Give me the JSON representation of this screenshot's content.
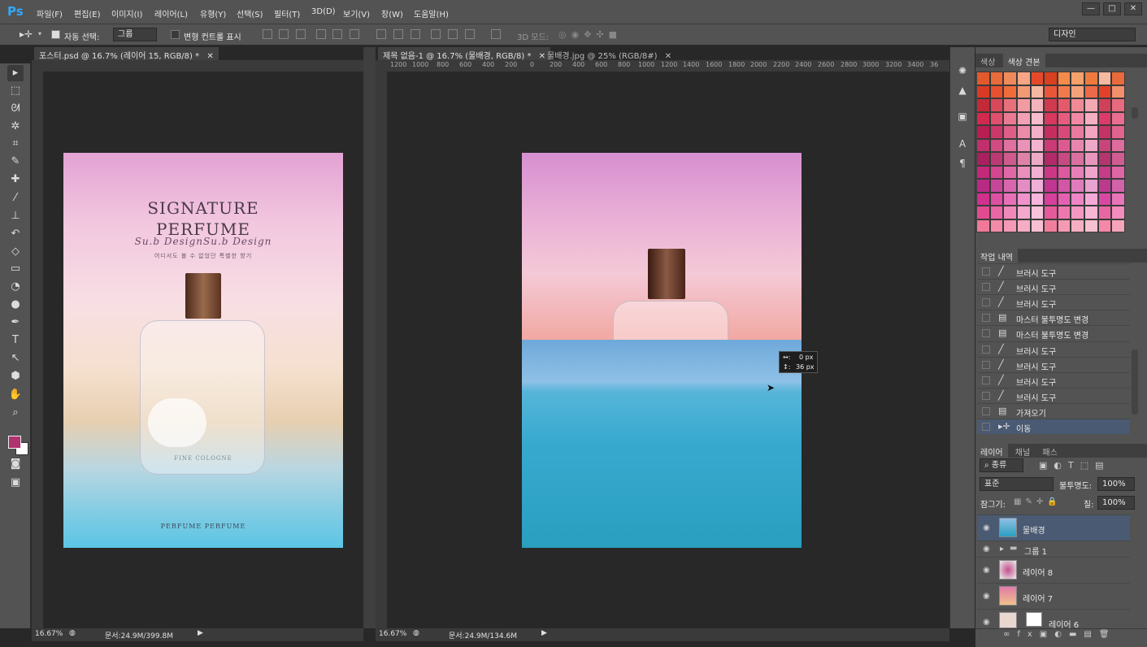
{
  "app": {
    "logo": "Ps"
  },
  "menu": [
    "파일(F)",
    "편집(E)",
    "이미지(I)",
    "레이어(L)",
    "유형(Y)",
    "선택(S)",
    "필터(T)",
    "3D(D)",
    "보기(V)",
    "창(W)",
    "도움말(H)"
  ],
  "window_buttons": [
    "—",
    "□",
    "✕"
  ],
  "options": {
    "auto_select_label": "자동 선택:",
    "auto_select_value": "그룹",
    "transform_label": "변형 컨트롤 표시",
    "mode3d_label": "3D 모드:",
    "workspace": "디자인"
  },
  "tabs_left": [
    {
      "label": "포스터.psd @ 16.7% (레이어 15, RGB/8) *",
      "close": "✕"
    }
  ],
  "tabs_right": [
    {
      "label": "제목 없음-1 @ 16.7% (물배경, RGB/8) *",
      "close": "✕"
    },
    {
      "label": "물배경.jpg @ 25% (RGB/8#)",
      "close": "✕"
    }
  ],
  "ruler_top": [
    "1200",
    "1000",
    "800",
    "600",
    "400",
    "200",
    "0",
    "200",
    "400",
    "600",
    "800",
    "1000",
    "1200",
    "1400",
    "1600",
    "1800",
    "2000",
    "2200",
    "2400",
    "2600",
    "2800",
    "3000",
    "3200",
    "3400",
    "36"
  ],
  "poster": {
    "title1": "SIGNATURE",
    "title2": "PERFUME",
    "script": "Su.b DesignSu.b Design",
    "tagline": "어디서도 볼 수 없었던 특별한 향기",
    "bottle_label": "FINE COLOGNE",
    "footer": "PERFUME PERFUME"
  },
  "move_tooltip": {
    "dx": "0 px",
    "dy": "36 px"
  },
  "status_left": {
    "zoom": "16.67%",
    "doc": "문서:24.9M/399.8M"
  },
  "status_right": {
    "zoom": "16.67%",
    "doc": "문서:24.9M/134.6M"
  },
  "swatch_panel": {
    "tabs": [
      "색상",
      "색상 견본"
    ]
  },
  "swatch_colors": [
    "#e25a2c",
    "#e96a3a",
    "#f08a5b",
    "#f7a585",
    "#e44a2a",
    "#d8401f",
    "#f58b4b",
    "#f4a16c",
    "#ef7a3e",
    "#f5b8a1",
    "#e96a3a",
    "#d93a26",
    "#e8502f",
    "#f06c3a",
    "#f39a75",
    "#f7b8a3",
    "#e9563a",
    "#f17a4d",
    "#f5a27c",
    "#ec6a4a",
    "#e2422a",
    "#f28f6c",
    "#c22a3a",
    "#d9485a",
    "#e8707a",
    "#f29aa2",
    "#f5b4bc",
    "#cf3a4e",
    "#e45a6a",
    "#f08a96",
    "#f4a8b2",
    "#d1405a",
    "#e86a7e",
    "#d12a4e",
    "#e0506e",
    "#ea7a92",
    "#f2a0b4",
    "#f6bdcc",
    "#d8385e",
    "#e65c7e",
    "#f189a4",
    "#f6aec2",
    "#dc3a68",
    "#eb6e92",
    "#b81e52",
    "#cc386a",
    "#de5e88",
    "#ec8aaa",
    "#f4b0c8",
    "#c72e60",
    "#d94a7a",
    "#e87aa0",
    "#f2a4c0",
    "#c43266",
    "#e0648e",
    "#c2306c",
    "#d24a82",
    "#e070a0",
    "#ea92b8",
    "#f2b4d0",
    "#ca3a76",
    "#dc5a90",
    "#e886b0",
    "#f0a8c8",
    "#c8447c",
    "#de6c9c",
    "#a8205e",
    "#bc3a74",
    "#cf5a8e",
    "#df82aa",
    "#ecaac8",
    "#b22a68",
    "#c84a82",
    "#da70a0",
    "#e896bc",
    "#b4366e",
    "#d05c92",
    "#c4287a",
    "#d44690",
    "#e068a6",
    "#ea8ebc",
    "#f2b0d2",
    "#cc3886",
    "#dc5aa0",
    "#e880b8",
    "#f0a4cc",
    "#c63c88",
    "#de66a6",
    "#b82a84",
    "#c8469a",
    "#d866ae",
    "#e48cc4",
    "#eeb0d8",
    "#c03690",
    "#d256a6",
    "#e07cbc",
    "#eaa2d0",
    "#bc3a8e",
    "#d262aa",
    "#d0308e",
    "#de50a4",
    "#e870b8",
    "#f092cc",
    "#f6b6de",
    "#d6409c",
    "#e460b2",
    "#ee86c6",
    "#f4aad8",
    "#d848a2",
    "#e874ba",
    "#e24a90",
    "#ea66a4",
    "#f088ba",
    "#f4a8cc",
    "#f8c4dc",
    "#e45a9a",
    "#ee78ae",
    "#f498c2",
    "#f6b6d4",
    "#e866a2",
    "#f28cbc",
    "#f07898",
    "#f28aa8",
    "#f49ab6",
    "#f6acc4",
    "#f8c0d2",
    "#f27e9e",
    "#f49ab2",
    "#f6aec2",
    "#f8c0d0",
    "#f488a6",
    "#f6a4bc"
  ],
  "history": {
    "tab": "작업 내역",
    "items": [
      "브러시 도구",
      "브러시 도구",
      "브러시 도구",
      "마스터 불투명도 변경",
      "마스터 불투명도 변경",
      "브러시 도구",
      "브러시 도구",
      "브러시 도구",
      "브러시 도구",
      "가져오기",
      "이동"
    ],
    "icons": [
      "brush-icon",
      "brush-icon",
      "brush-icon",
      "document-icon",
      "document-icon",
      "brush-icon",
      "brush-icon",
      "brush-icon",
      "brush-icon",
      "document-icon",
      "move-icon"
    ]
  },
  "layers_panel": {
    "tabs": [
      "레이어",
      "채널",
      "패스"
    ],
    "filter": "종류",
    "blend": "표준",
    "opacity_label": "불투명도:",
    "opacity": "100%",
    "lock_label": "잠그기:",
    "fill_label": "칠:",
    "fill": "100%",
    "layers": [
      "물배경",
      "그룹 1",
      "레이어 8",
      "레이어 7",
      "레이어 6"
    ]
  },
  "colors": {
    "accent": "#31a8ff",
    "foreground": "#b0326e",
    "background": "#ffffff",
    "selection": "#4a5a72"
  }
}
